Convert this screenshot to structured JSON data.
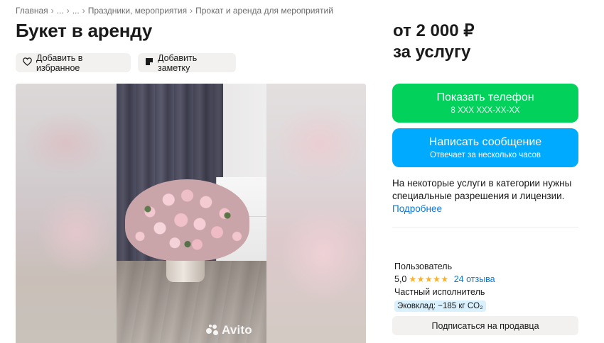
{
  "breadcrumb": {
    "items": [
      "Главная",
      "...",
      "...",
      "Праздники, мероприятия",
      "Прокат и аренда для мероприятий"
    ],
    "separator": "›"
  },
  "listing": {
    "title": "Букет в аренду",
    "price_line1": "от 2 000 ₽",
    "price_line2": "за услугу"
  },
  "actions": {
    "favorite_label": "Добавить в избранное",
    "note_label": "Добавить заметку"
  },
  "gallery": {
    "watermark": "Avito"
  },
  "contact": {
    "phone_label": "Показать телефон",
    "phone_masked": "8 XXX XXX-XX-XX",
    "message_label": "Написать сообщение",
    "message_sub": "Отвечает за несколько часов"
  },
  "notice": {
    "text": "На некоторые услуги в категории нужны специальные разрешения и лицензии.",
    "more_link": "Подробнее"
  },
  "seller": {
    "name": "Пользователь",
    "rating": "5,0",
    "stars": "★★★★★",
    "reviews": "24 отзыва",
    "type": "Частный исполнитель",
    "eco_badge": "Эковклад: −185 кг CO₂",
    "subscribe_label": "Подписаться на продавца"
  },
  "colors": {
    "phone_button": "#02d15c",
    "message_button": "#00aaff",
    "link": "#0a7bd9",
    "star": "#ffb021",
    "eco_badge_bg": "#d9f0fd"
  },
  "icons": {
    "favorite": "heart-icon",
    "note": "note-icon",
    "watermark": "avito-logo-icon"
  }
}
